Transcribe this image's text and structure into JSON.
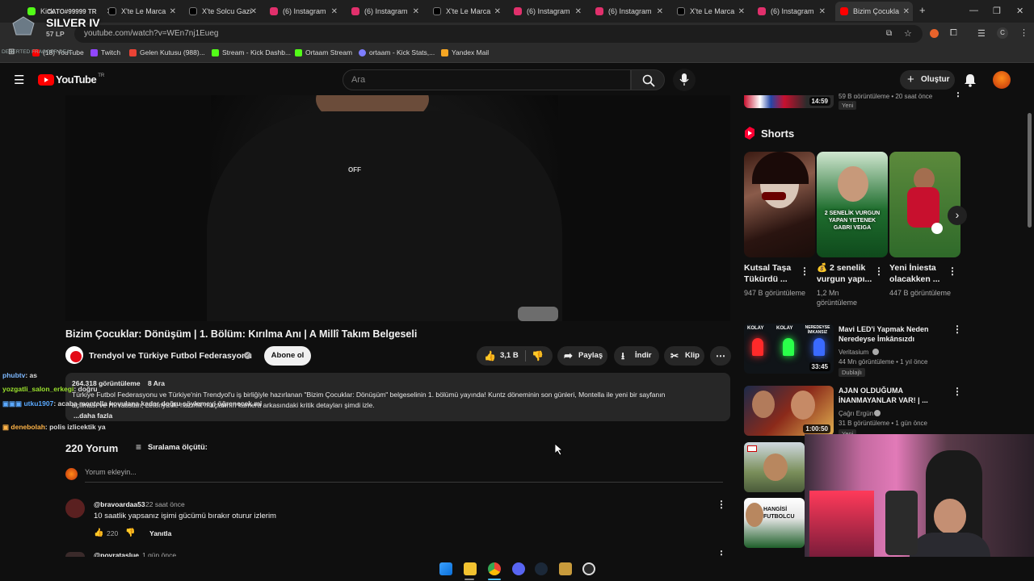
{
  "browser": {
    "tabs": [
      {
        "label": "Kick",
        "icon_color": "#53fc18"
      },
      {
        "label": "X'te Le Marca",
        "icon_color": "#000000"
      },
      {
        "label": "X'te Solcu Gazi",
        "icon_color": "#000000"
      },
      {
        "label": "(6) Instagram",
        "icon_color": "#e1306c"
      },
      {
        "label": "(6) Instagram",
        "icon_color": "#e1306c"
      },
      {
        "label": "X'te Le Marca",
        "icon_color": "#000000"
      },
      {
        "label": "(6) Instagram",
        "icon_color": "#e1306c"
      },
      {
        "label": "(6) Instagram",
        "icon_color": "#e1306c"
      },
      {
        "label": "X'te Le Marca",
        "icon_color": "#000000"
      },
      {
        "label": "(6) Instagram",
        "icon_color": "#e1306c"
      },
      {
        "label": "Bizim Çocukla",
        "icon_color": "#ff0000"
      }
    ],
    "new_tab": "+",
    "url": "youtube.com/watch?v=WEn7nj1Eueg",
    "bookmarks": [
      {
        "label": "(18) YouTube",
        "color": "#ff0000"
      },
      {
        "label": "Twitch",
        "color": "#9146ff"
      },
      {
        "label": "Gelen Kutusu (988)...",
        "color": "#ea4335"
      },
      {
        "label": "Stream - Kick Dashb...",
        "color": "#53fc18"
      },
      {
        "label": "Ortaam Stream",
        "color": "#53fc18"
      },
      {
        "label": "ortaam - Kick Stats,...",
        "color": "#7d7dff"
      },
      {
        "label": "Yandex Mail",
        "color": "#f5a623"
      }
    ]
  },
  "overlay": {
    "rank": "SILVER IV",
    "lp": "57 LP",
    "account": "CATO#99999 TR",
    "tag": "DESERTED FRAGGER DEAL"
  },
  "youtube": {
    "logo_text": "YouTube",
    "region": "TR",
    "search_placeholder": "Ara",
    "create_label": "Oluştur",
    "video": {
      "overlay_text": "OFF",
      "title": "Bizim Çocuklar: Dönüşüm | 1. Bölüm: Kırılma Anı | A Millî Takım Belgeseli",
      "channel": "Trendyol ve Türkiye Futbol Federasyonu",
      "subscribe": "Abone ol",
      "likes": "3,1 B",
      "share": "Paylaş",
      "download": "İndir",
      "clip": "Klip",
      "views": "264.318 görüntüleme",
      "date": "8 Ara",
      "desc_line1": "Türkiye Futbol Federasyonu ve Türkiye'nin Trendyol'u iş birliğiyle hazırlanan \"Bizim Çocuklar: Dönüşüm\" belgeselinin 1. bölümü yayında! Kuntz döneminin son günleri, Montella ile yeni bir sayfanın",
      "desc_line2": "açılması ve Hırvatistan, Letonya ile hazırlık maçlarının kamera arkasındaki kritik detayları şimdi izle.",
      "desc_more": "...daha fazla"
    },
    "comments": {
      "count_label": "220 Yorum",
      "sort_label": "Sıralama ölçütü:",
      "add_placeholder": "Yorum ekleyin...",
      "items": [
        {
          "user": "@bravoardaa53",
          "time": "22 saat önce",
          "text": "10 saatlik yapsanız işimi gücümü bırakır oturur izlerim",
          "likes": "220",
          "reply": "Yanıtla"
        },
        {
          "user": "@povrataslue",
          "time": "1 gün önce",
          "text": "",
          "likes": "",
          "reply": ""
        }
      ]
    },
    "sidebar": {
      "top_item": {
        "duration": "14:59",
        "meta": "59 B görüntüleme • 20 saat önce",
        "badge": "Yeni"
      },
      "shorts_label": "Shorts",
      "shorts": [
        {
          "title": "Kutsal Taşa Tükürdü ...",
          "views": "947 B görüntüleme",
          "thumb_text": ""
        },
        {
          "title": "💰 2 senelik vurgun yapı...",
          "views": "1,2 Mn görüntüleme",
          "thumb_text": "2 SENELİK VURGUN YAPAN YETENEK GABRI VEIGA"
        },
        {
          "title": "Yeni İniesta olacakken ...",
          "views": "447 B görüntüleme",
          "thumb_text": ""
        }
      ],
      "videos": [
        {
          "title": "Mavi LED'i Yapmak Neden Neredeyse İmkânsızdı",
          "channel": "Veritasium",
          "meta": "44 Mn görüntüleme • 1 yıl önce",
          "badge": "Dublajlı",
          "duration": "33:45",
          "thumb_labels": [
            "KOLAY",
            "KOLAY",
            "NEREDEYSE İMKANSIZ"
          ]
        },
        {
          "title": "AJAN OLDUĞUMA İNANMAYANLAR VAR! | ...",
          "channel": "Çağrı Ergün",
          "meta": "31 B görüntüleme • 1 gün önce",
          "badge": "Yeni",
          "duration": "1:00:50",
          "thumb_labels": []
        },
        {
          "title": "",
          "channel": "",
          "meta": "",
          "badge": "",
          "duration": "",
          "thumb_labels": []
        },
        {
          "title": "",
          "channel": "",
          "meta": "",
          "badge": "",
          "duration": "",
          "thumb_labels": [
            "HANGİSİ FUTBOLCU"
          ]
        }
      ]
    }
  },
  "chat": [
    {
      "user": "phubtv",
      "msg": ": as",
      "color": "#7db8ff"
    },
    {
      "user": "yozgatli_salon_erkegi",
      "msg": ": doğru",
      "color": "#9be22d"
    },
    {
      "user": "utku1907",
      "msg": ": acaba montella kovulana kadar doğru söylemeyi öğrenecek mi",
      "color": "#5aa9ff"
    },
    {
      "user": "denebolah",
      "msg": ": polis izlicektik ya",
      "color": "#ffb347"
    }
  ]
}
